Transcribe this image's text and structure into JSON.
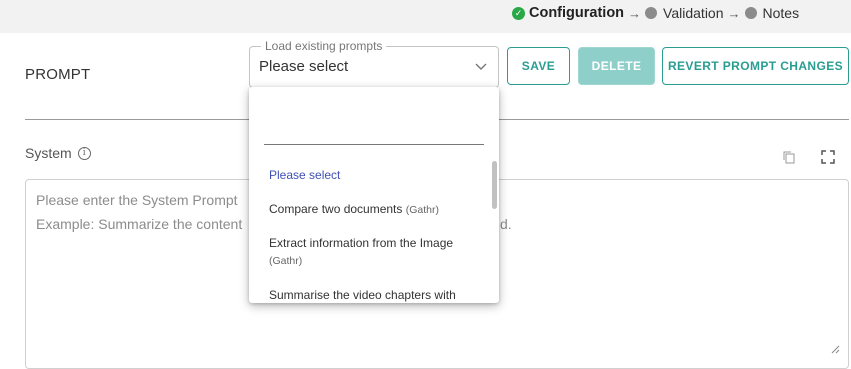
{
  "stepper": {
    "steps": [
      {
        "label": "Configuration",
        "state": "complete"
      },
      {
        "label": "Validation",
        "state": "pending"
      },
      {
        "label": "Notes",
        "state": "pending"
      }
    ],
    "arrow": "→"
  },
  "prompt_section": {
    "title": "PROMPT",
    "load_select": {
      "legend": "Load existing prompts",
      "value": "Please select",
      "search_value": "",
      "options": [
        {
          "label": "Please select",
          "tag": "",
          "selected": true
        },
        {
          "label": "Compare two documents",
          "tag": "(Gathr)",
          "selected": false
        },
        {
          "label": "Extract information from the Image",
          "tag": "(Gathr)",
          "selected": false
        },
        {
          "label": "Summarise the video chapters with",
          "tag": "",
          "selected": false
        }
      ]
    },
    "buttons": {
      "save": "SAVE",
      "delete": "DELETE",
      "revert": "REVERT PROMPT CHANGES"
    }
  },
  "system": {
    "label": "System",
    "info_icon": "ⓘ",
    "placeholder_line1": "Please enter the System Prompt",
    "placeholder_line2": "Example: Summarize the content",
    "placeholder_line2_tail": "d."
  },
  "colors": {
    "accent": "#2a9d92",
    "accent_disabled": "#8ecfc9",
    "complete": "#2aa845",
    "selected_option": "#3f51b5"
  }
}
